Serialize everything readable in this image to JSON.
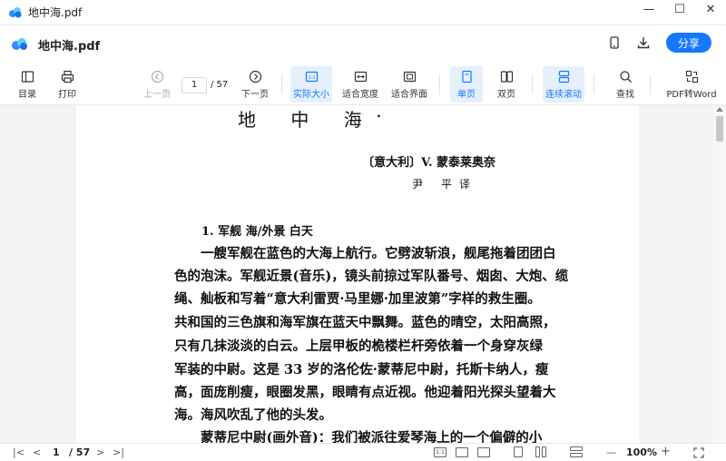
{
  "window": {
    "title": "地中海.pdf",
    "controls": [
      "—",
      "☐",
      "✕"
    ]
  },
  "header": {
    "file_name": "地中海.pdf",
    "share_label": "分享"
  },
  "toolbar": {
    "contents": "目录",
    "print": "打印",
    "prev_page": "上一页",
    "page_current": "1",
    "page_total": "/ 57",
    "next_page": "下一页",
    "actual_size": "实际大小",
    "fit_width": "适合宽度",
    "fit_page": "适合界面",
    "single_page": "单页",
    "double_page": "双页",
    "continuous": "连续滚动",
    "find": "查找",
    "pdf_to_word": "PDF转Word",
    "actual_size_icon_text": "1:1"
  },
  "document": {
    "title": "地 中 海",
    "title_mark": "•",
    "author": "〔意大利〕V. 蒙泰莱奥奈",
    "translator": "尹  平译",
    "section": "1. 军舰    海/外景    白天",
    "paragraphs": [
      "　　一艘军舰在蓝色的大海上航行。它劈波斩浪，舰尾拖着团团白",
      "色的泡沫。军舰近景(音乐)，镜头前掠过军队番号、烟囱、大炮、缆",
      "绳、舢板和写着“意大利雷贾·马里娜·加里波第”字样的救生圈。",
      "共和国的三色旗和海军旗在蓝天中飘舞。蓝色的晴空，太阳高照，",
      "只有几抹淡淡的白云。上层甲板的桅楼栏杆旁依着一个身穿灰绿",
      "军装的中尉。这是 33 岁的洛伦佐·蒙蒂尼中尉，托斯卡纳人，瘦",
      "高，面庞削瘦，眼圈发黑，眼睛有点近视。他迎着阳光探头望着大",
      "海。海风吹乱了他的头发。",
      "　　蒙蒂尼中尉(画外音)：我们被派往爱琴海上的一个偏僻的小"
    ]
  },
  "statusbar": {
    "first": "|<",
    "prev": "<",
    "page_current": "1",
    "page_total": "/ 57",
    "next": ">",
    "last": ">|",
    "zoom_out": "—",
    "zoom": "100%",
    "zoom_in": "+",
    "box_1to1": "1:1"
  },
  "colors": {
    "accent": "#1677ff",
    "active_bg": "#e6f0fd"
  }
}
